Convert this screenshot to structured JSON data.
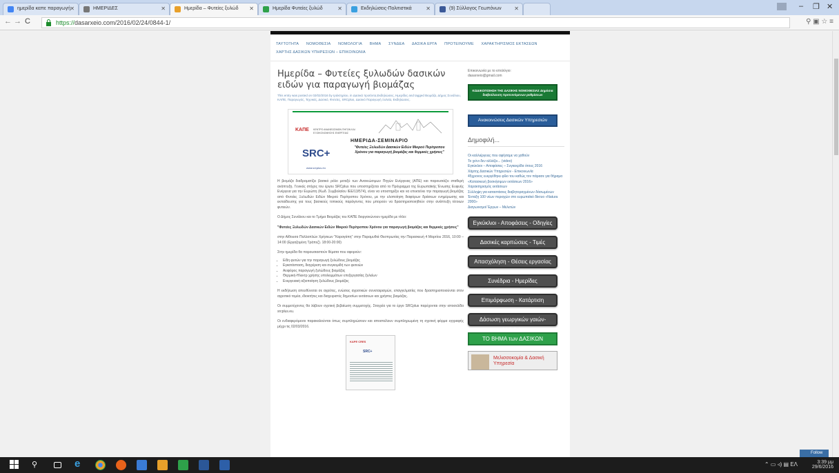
{
  "browser": {
    "tabs": [
      {
        "label": "ημερίδα καπε παραγωγή",
        "color": "#4285f4",
        "active": false
      },
      {
        "label": "ΗΜΕΡΙΔΕΣ",
        "color": "#777777",
        "active": false
      },
      {
        "label": "Ημερίδα – Φυτείες ξυλώδ",
        "color": "#e8a02a",
        "active": true
      },
      {
        "label": "Ημερίδα Φυτείες ξυλώδ",
        "color": "#2ea14a",
        "active": false
      },
      {
        "label": "Εκδηλώσεις-Πολιτιστικά",
        "color": "#3aa0e0",
        "active": false
      },
      {
        "label": "(9) Σύλλογος Γεωπόνων",
        "color": "#3b5998",
        "active": false
      }
    ],
    "url_https": "https://",
    "url_rest": "dasarxeio.com/2016/02/24/0844-1/"
  },
  "site": {
    "menu": [
      "ΤΑΥΤΟΤΗΤΑ",
      "ΝΟΜΟΘΕΣΙΑ",
      "ΝΟΜΟΛΟΓΙΑ",
      "ΒΗΜΑ",
      "ΣΥΝΔΕΑ",
      "ΔΑΣΙΚΑ ΕΡΓΑ",
      "ΠΡΟΤΕΙΝΟΥΜΕ",
      "ΧΑΡΑΚΤΗΡΙΣΜΟΣ ΕΚΤΑΣΕΩΝ",
      "ΧΑΡΤΗΣ ΔΑΣΙΚΩΝ ΥΠΗΡΕΣΙΩΝ – ΕΠΙΚΟΙΝΩΝΙΑ"
    ],
    "post": {
      "title": "Ημερίδα – Φυτείες ξυλωδών δασικών ειδών για παραγωγή βιομάζας",
      "meta": "This entry was posted on 02/02/2016 by Ιράκτηρίου, in Δασικά πρoϊόντα,Εκδηλώσεις, Ημερίδες and tagged Βιομάζα, Δήμος Συνάλιου, ΚΑΠΕ, Παραγωγός, Τεχνικές, Δασικό, Φυτείες, SRCplus, Δασικό Παραγωγή Ξυλεία, Εκδηλώσεις.",
      "banner": {
        "kape": "ΚΑΠΕ",
        "kape_sub": "ΚΕΝΤΡΟ ΑΝΑΝΕΩΣΙΜΩΝ ΠΗΓΩΝ ΚΑΙ ΕΞΟΙΚΟΝΟΜΗΣΗΣ ΕΝΕΡΓΕΙΑΣ",
        "heading": "ΗΜΕΡΙΔΑ-ΣΕΜΙΝΑΡΙΟ",
        "subtitle": "\"Φυτείες Ξυλωδών Δασικών Ειδών Μικρού Περίτροπου Χρόνου για παραγωγή βιομάζας και θερμικές χρήσεις\"",
        "logo": "SRC+",
        "www": "www.srcplus.eu"
      },
      "paragraphs": [
        "Η βιομάζα διαδραματίζει βασικό ρόλο μεταξύ των Ανανεώσιμων Πηγών Ενέργειας (ΑΠΕ) και παρουσιάζει σταθερή ανάπτυξη. Γενικός στόχος του έργου SRCplus που υποστηρίζεται από το Πρόγραμμα της Ευρωπαϊκής Ένωσης Ευφυής Ενέργεια για την Ευρώπη (Κωδ. Συμβολαίου ΙΕΕ/13/574), είναι να υποστηρίξει και να επεκτείνει την παραγωγή βιομάζας από Φυτείες Ξυλωδών Ειδών Μικρού Περίτροπου Χρόνου, με την υλοποίηση διαφόρων δράσεων ενημέρωσης και εκπαίδευσης για τους βασικούς τοπικούς παράγοντες που μπορούν να δραστηριοποιηθούν στην ανάπτυξη τέτοιων φυτειών.",
        "Ο Δήμος Συνάλιου και το Τμήμα Βιομάζας του ΚΑΠΕ διοργανώνουν ημερίδα με τίτλο:",
        "\"Φυτείες Ξυλωδών Δασικών Ειδών Μικρού Περίτροπου Χρόνου για παραγωγή βιομάζας και θερμικές χρήσεις\"",
        "στην Αίθουσα Πολλαπλών Χρήσεων \"Καραγάπη\" στην Παραμυθιά Θεσπρωτίας την Παρασκευή 4 Μαρτίου 2016, 10:00 – 14:00 (Εργαζομένη Τράπεζ). 18:00-20:00)",
        "Στην ημερίδα θα παρουσιαστούν θέματα που αφορούν:"
      ],
      "bullets": [
        "Είδη φυτών για την παραγωγή ξυλώδους βιομάζας",
        "Εγκατάσταση, διαχείριση και συγκομιδή των φυτειών",
        "Αειφόρος παραγωγή ξυλώδους βιομάζας",
        "Θερμική-Ηλεκτρ χρήσης υπολειμμάτων επεξεργασίας ξυλείων",
        "Ενεργειακή αξιοποίηση ξυλώδους βιομάζας"
      ],
      "paragraphs2": [
        "Η εκδήλωση απευθύνεται σε αγρότες, ενώσεις αγροτικών συνεταιρισμών, επαγγελματίες που δραστηριοποιούνται στον αγροτικό τομέα, ιδιοκτήτες και διαχειριστές δημοσίων εκτάσεων και χρήστες βιομάζας.",
        "Οι συμμετέχοντες θα λάβουν σχετική βεβαίωση συμμετοχής. Στοιχεία για το έργο SRCplus παρέχονται στην ιστοσελίδα srcplus.eu.",
        "Οι ενδιαφερόμενοι παρακαλούνται όπως συμπληρώσουν και αποστείλουν συμπληρωμένη τη σχετική φόρμα εγγραφής μέχρι τις 02/03/2016."
      ],
      "doc_thumb": {
        "hd": "KAPE CRES",
        "logo": "SRC+"
      }
    },
    "sidebar": {
      "contact": "Επικοινωνία με το ιστολόγιο:",
      "email": "dasarxeio@gmail.com",
      "green_button": "ΚΩΔΙΚΟΠΟΙΗΣΗ ΤΗΣ ΔΑΣΙΚΗΣ ΝΟΜΟΘΕΣΙΑΣ Δημόσια διαβούλευση προτεινόμενων ρυθμίσεων",
      "blue_button": "Ανακοινώσεις Δασικών Υπηρεσιών",
      "popular_title": "Δημοφιλή...",
      "popular": [
        "Οι καλλιέργειες που αφήσαμε να χαθούν",
        "Το χιόνι δεν αλλάζει... (video)",
        "Εγκύκλιοι – Αποφάσεις – Συγκεκρίδα ότους 2016",
        "Χάρτης Δασικών Υπηρεσιών - Επικοινωνία",
        "45χρονος ευεργέθηκε φίλο του καθώς τον πάρασε για θήραμα",
        "«Κατασκευή βοσκήσιμων εκτάσεων 2016»",
        "Χαρακτηρισμός εκτάσεων",
        "Σύλληψη για καταστάσεις διαβητοραγμένων δάσωμένων",
        "Ένταξη 100 νέων περιοχών στο ευρωπαϊκό δίκτυο «Natura 2000»",
        "Διαγωνισμοί Έργων – Μελετών"
      ],
      "grey_buttons": [
        "Εγκύκλιοι - Αποφάσεις - Οδηγίες",
        "Δασικές καρπώσεις - Τιμές",
        "Απασχόληση - Θέσεις εργασίας",
        "Συνέδρια - Ημερίδες",
        "Επιμόρφωση - Κατάρτιση",
        "Δάσωση γεωργικών γαιών- Μ.2.2.1."
      ],
      "vima_button": "ΤΟ ΒΗΜΑ των ΔΑΣΙΚΩΝ",
      "melissa": "Μελισσοκομία & Δασική Υπηρεσία"
    },
    "follow": "Follow"
  },
  "taskbar": {
    "time": "3:39 μμ",
    "date": "29/6/2016",
    "lang": "ΕΛ"
  }
}
